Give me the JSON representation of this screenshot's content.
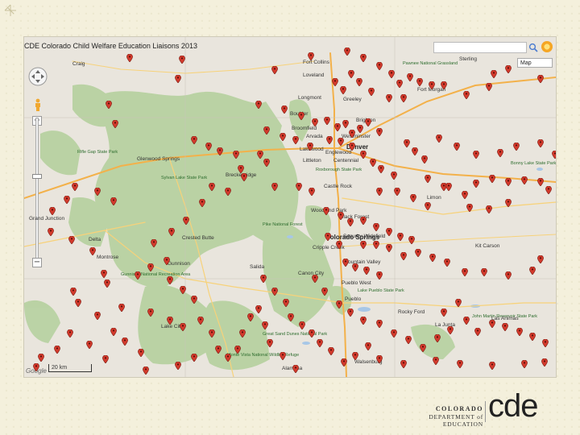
{
  "map": {
    "title": "CDE Colorado Child Welfare Education Liaisons 2013",
    "map_type_label": "Map",
    "scale_label": "20 km",
    "google_label": "Google",
    "colors": {
      "land": "#e7e3dc",
      "forest": "#b9d3a4",
      "water": "#a6c8e8",
      "pin": "#d33a2c",
      "road": "#f3b14a"
    },
    "labels": [
      {
        "text": "Fort Collins",
        "type": "city"
      },
      {
        "text": "Loveland",
        "type": "city"
      },
      {
        "text": "Longmont",
        "type": "city"
      },
      {
        "text": "Boulder",
        "type": "city"
      },
      {
        "text": "Broomfield",
        "type": "city"
      },
      {
        "text": "Westminster",
        "type": "city"
      },
      {
        "text": "Arvada",
        "type": "city"
      },
      {
        "text": "Denver",
        "type": "big"
      },
      {
        "text": "Lakewood",
        "type": "city"
      },
      {
        "text": "Englewood",
        "type": "city"
      },
      {
        "text": "Centennial",
        "type": "city"
      },
      {
        "text": "Littleton",
        "type": "city"
      },
      {
        "text": "Roxborough State Park",
        "type": "park"
      },
      {
        "text": "Castle Rock",
        "type": "city"
      },
      {
        "text": "Woodland Park",
        "type": "city"
      },
      {
        "text": "Black Forest",
        "type": "city"
      },
      {
        "text": "Colorado Springs",
        "type": "big"
      },
      {
        "text": "Security-Widefield",
        "type": "city"
      },
      {
        "text": "Fountain Valley",
        "type": "city"
      },
      {
        "text": "Canon City",
        "type": "city"
      },
      {
        "text": "Pueblo West",
        "type": "city"
      },
      {
        "text": "Pueblo",
        "type": "city"
      },
      {
        "text": "Greeley",
        "type": "city"
      },
      {
        "text": "Brighton",
        "type": "city"
      },
      {
        "text": "Glenwood Springs",
        "type": "city"
      },
      {
        "text": "Breckenridge",
        "type": "city"
      },
      {
        "text": "Grand Junction",
        "type": "city"
      },
      {
        "text": "Gunnison",
        "type": "city"
      },
      {
        "text": "Salida",
        "type": "city"
      },
      {
        "text": "La Junta",
        "type": "city"
      },
      {
        "text": "Lake Pueblo State Park",
        "type": "park"
      },
      {
        "text": "Great Sand Dunes National Park",
        "type": "park"
      },
      {
        "text": "Monte Vista National Wildlife Refuge",
        "type": "park"
      },
      {
        "text": "Pawnee National Grassland",
        "type": "park"
      },
      {
        "text": "Pike National Forest",
        "type": "park"
      },
      {
        "text": "Gunnison National Recreation Area",
        "type": "park"
      },
      {
        "text": "Sylvan Lake State Park",
        "type": "park"
      },
      {
        "text": "Rifle Gap State Park",
        "type": "park"
      },
      {
        "text": "Bonny Lake State Park",
        "type": "park"
      },
      {
        "text": "John Martin Reservoir State Park",
        "type": "park"
      },
      {
        "text": "Sterling",
        "type": "city"
      },
      {
        "text": "Fort Morgan",
        "type": "city"
      },
      {
        "text": "Craig",
        "type": "city"
      },
      {
        "text": "Delta",
        "type": "city"
      },
      {
        "text": "Montrose",
        "type": "city"
      },
      {
        "text": "Lake City",
        "type": "city"
      },
      {
        "text": "Crested Butte",
        "type": "city"
      },
      {
        "text": "Cripple Creek",
        "type": "city"
      },
      {
        "text": "Rocky Ford",
        "type": "city"
      },
      {
        "text": "Las Animas",
        "type": "city"
      },
      {
        "text": "Kit Carson",
        "type": "city"
      },
      {
        "text": "Limon",
        "type": "city"
      },
      {
        "text": "Walsenburg",
        "type": "city"
      },
      {
        "text": "Alamosa",
        "type": "city"
      }
    ]
  },
  "footer": {
    "org_line1": "COLORADO",
    "org_line2": "DEPARTMENT of EDUCATION",
    "logo_text": "cde"
  }
}
